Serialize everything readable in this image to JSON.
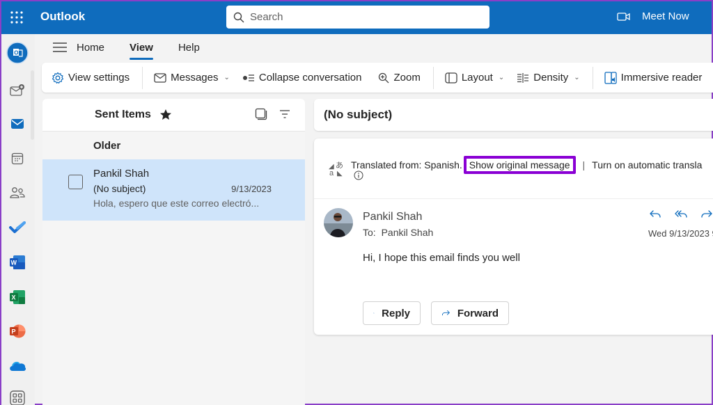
{
  "topbar": {
    "app_name": "Outlook",
    "search_placeholder": "Search",
    "meet_now": "Meet Now",
    "colors": {
      "brand": "#0f6cbd"
    }
  },
  "rail": {
    "items": [
      {
        "name": "outlook-app",
        "icon": "outlook-icon"
      },
      {
        "name": "new-mail",
        "icon": "mail-add-icon"
      },
      {
        "name": "mail",
        "icon": "mail-icon"
      },
      {
        "name": "calendar",
        "icon": "calendar-icon"
      },
      {
        "name": "people",
        "icon": "people-icon"
      },
      {
        "name": "to-do",
        "icon": "checkmark-icon"
      },
      {
        "name": "word",
        "icon": "word-icon"
      },
      {
        "name": "excel",
        "icon": "excel-icon"
      },
      {
        "name": "powerpoint",
        "icon": "powerpoint-icon"
      },
      {
        "name": "onedrive",
        "icon": "onedrive-icon"
      },
      {
        "name": "more-apps",
        "icon": "apps-icon"
      }
    ]
  },
  "ribbon": {
    "tabs": [
      {
        "label": "Home",
        "active": false
      },
      {
        "label": "View",
        "active": true
      },
      {
        "label": "Help",
        "active": false
      }
    ],
    "toolbar": {
      "view_settings": "View settings",
      "messages": "Messages",
      "collapse_conversation": "Collapse conversation",
      "zoom": "Zoom",
      "layout": "Layout",
      "density": "Density",
      "immersive_reader": "Immersive reader"
    }
  },
  "list": {
    "folder_title": "Sent Items",
    "group_label": "Older",
    "items": [
      {
        "sender": "Pankil Shah",
        "subject": "(No subject)",
        "date": "9/13/2023",
        "preview": "Hola, espero que este correo electró...",
        "selected": true
      }
    ]
  },
  "reading": {
    "subject": "(No subject)",
    "translation": {
      "translated_from": "Translated from: Spanish.",
      "show_original": "Show original message",
      "separator": "|",
      "auto_translate": "Turn on automatic transla"
    },
    "message": {
      "sender": "Pankil Shah",
      "to_label": "To:",
      "to": "Pankil Shah",
      "date": "Wed 9/13/2023 9",
      "body": "Hi, I hope this email finds you well"
    },
    "reply_label": "Reply",
    "forward_label": "Forward",
    "highlight_color": "#8a00d4"
  }
}
